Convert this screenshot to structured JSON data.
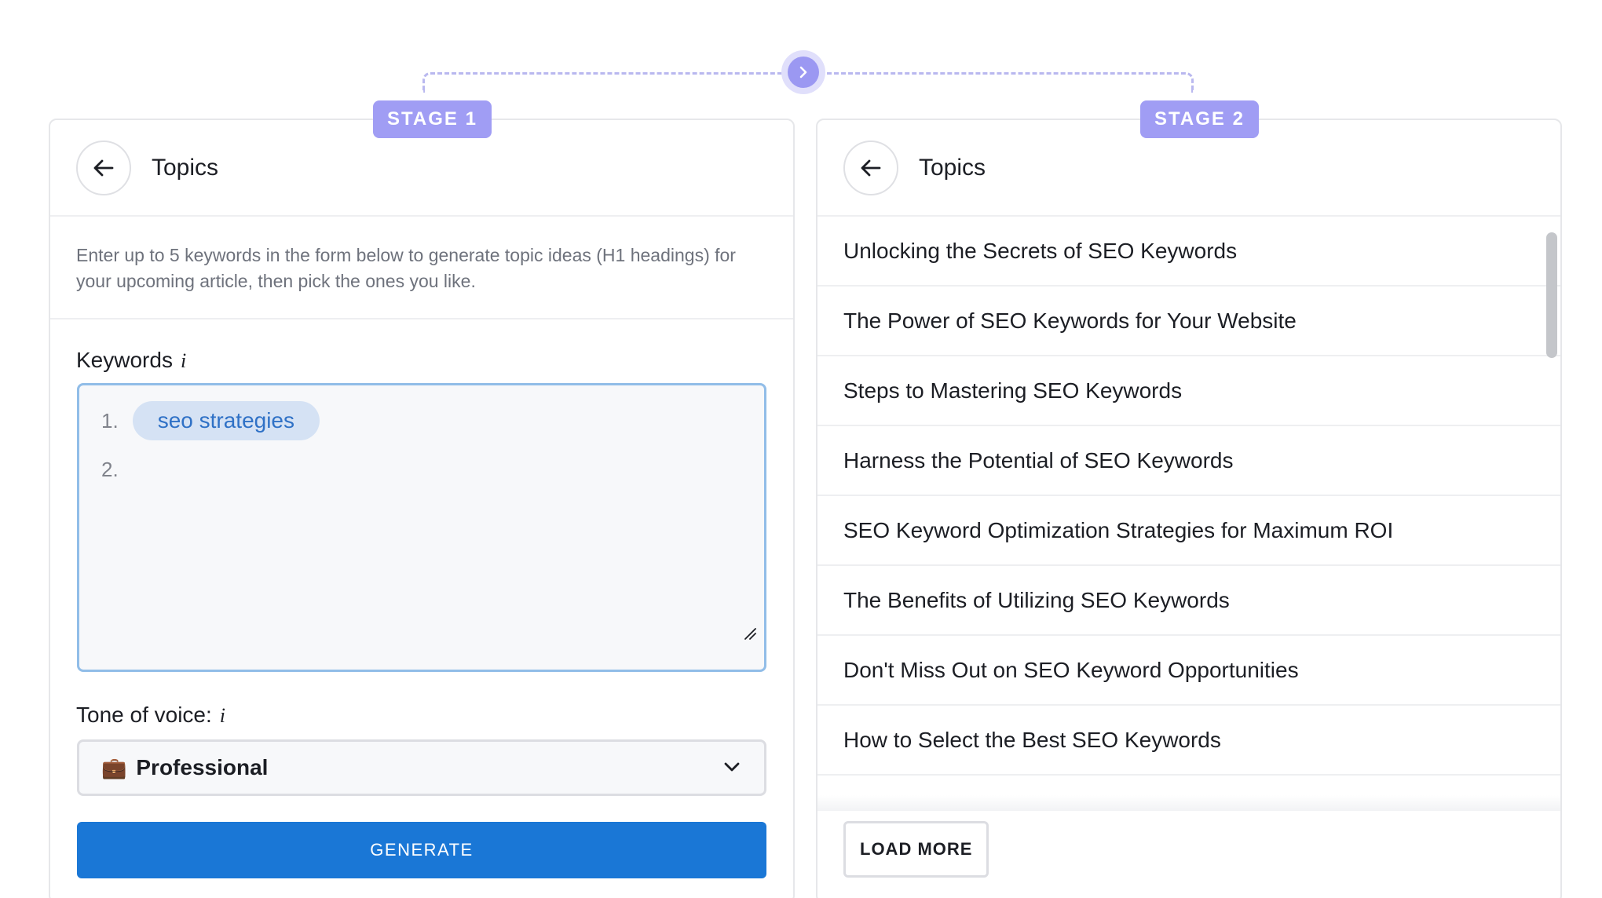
{
  "colors": {
    "accent_purple": "#a09df4",
    "primary_blue": "#1a77d6",
    "chip_bg": "#d5e2f4",
    "chip_text": "#2f71c6"
  },
  "stage1": {
    "badge": "STAGE 1",
    "header_title": "Topics",
    "intro": "Enter up to 5 keywords in the form below to generate topic ideas (H1 headings) for your upcoming article, then pick the ones you like.",
    "keywords_label": "Keywords",
    "info_glyph": "i",
    "keywords": [
      {
        "number": "1.",
        "value": "seo strategies"
      },
      {
        "number": "2.",
        "value": ""
      }
    ],
    "tone_label": "Tone of voice:",
    "tone_icon": "briefcase-icon",
    "tone_emoji": "💼",
    "tone_value": "Professional",
    "generate_label": "GENERATE"
  },
  "stage2": {
    "badge": "STAGE 2",
    "header_title": "Topics",
    "topics": [
      "Unlocking the Secrets of SEO Keywords",
      "The Power of SEO Keywords for Your Website",
      "Steps to Mastering SEO Keywords",
      "Harness the Potential of SEO Keywords",
      "SEO Keyword Optimization Strategies for Maximum ROI",
      "The Benefits of Utilizing SEO Keywords",
      "Don't Miss Out on SEO Keyword Opportunities",
      "How to Select the Best SEO Keywords"
    ],
    "load_more_label": "LOAD MORE"
  }
}
